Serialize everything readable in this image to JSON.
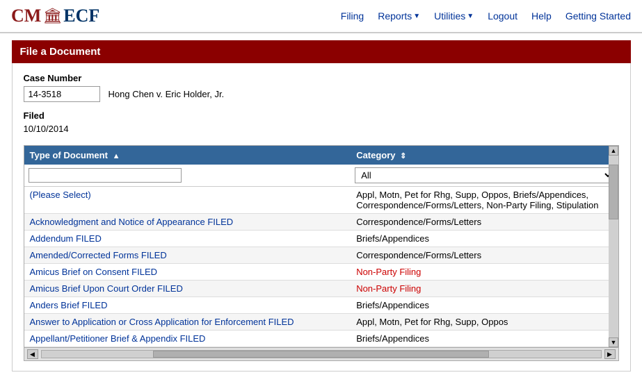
{
  "logo": {
    "cm": "CM",
    "icon": "🏛",
    "ecf": "ECF"
  },
  "nav": {
    "filing": "Filing",
    "reports": "Reports",
    "utilities": "Utilities",
    "logout": "Logout",
    "help": "Help",
    "getting_started": "Getting Started"
  },
  "page": {
    "title": "File a Document",
    "case_number_label": "Case Number",
    "case_number_value": "14-3518",
    "case_name": "Hong Chen v. Eric Holder, Jr.",
    "filed_label": "Filed",
    "filed_date": "10/10/2014"
  },
  "table": {
    "col1_label": "Type of Document",
    "col1_sort": "▲",
    "col2_label": "Category",
    "col2_sort": "⇕",
    "filter_placeholder": "",
    "category_options": [
      "All"
    ],
    "category_selected": "All"
  },
  "rows": [
    {
      "type": "(Please Select)",
      "category": "Appl, Motn, Pet for Rhg, Supp, Oppos, Briefs/Appendices, Correspondence/Forms/Letters, Non-Party Filing, Stipulation",
      "type_class": "link-blue",
      "category_class": "plain"
    },
    {
      "type": "Acknowledgment and Notice of Appearance FILED",
      "category": "Correspondence/Forms/Letters",
      "type_class": "link-blue",
      "category_class": "plain"
    },
    {
      "type": "Addendum FILED",
      "category": "Briefs/Appendices",
      "type_class": "link-blue",
      "category_class": "plain"
    },
    {
      "type": "Amended/Corrected Forms FILED",
      "category": "Correspondence/Forms/Letters",
      "type_class": "link-blue",
      "category_class": "plain"
    },
    {
      "type": "Amicus Brief on Consent FILED",
      "category": "Non-Party Filing",
      "type_class": "link-blue",
      "category_class": "link-red"
    },
    {
      "type": "Amicus Brief Upon Court Order FILED",
      "category": "Non-Party Filing",
      "type_class": "link-blue",
      "category_class": "link-red"
    },
    {
      "type": "Anders Brief FILED",
      "category": "Briefs/Appendices",
      "type_class": "link-blue",
      "category_class": "plain"
    },
    {
      "type": "Answer to Application or Cross Application for Enforcement FILED",
      "category": "Appl, Motn, Pet for Rhg, Supp, Oppos",
      "type_class": "link-blue",
      "category_class": "plain"
    },
    {
      "type": "Appellant/Petitioner Brief & Appendix FILED",
      "category": "Briefs/Appendices",
      "type_class": "link-blue",
      "category_class": "plain"
    }
  ]
}
